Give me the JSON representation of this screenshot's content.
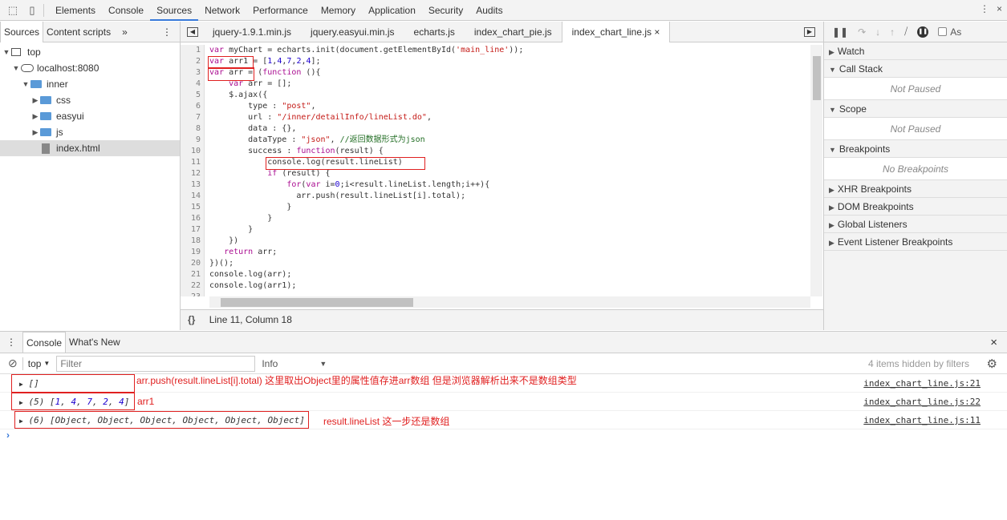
{
  "toolbar": {
    "tabs": [
      "Elements",
      "Console",
      "Sources",
      "Network",
      "Performance",
      "Memory",
      "Application",
      "Security",
      "Audits"
    ],
    "active": "Sources"
  },
  "navigator": {
    "tabs": [
      "Sources",
      "Content scripts"
    ],
    "more": "»",
    "tree": {
      "top": "top",
      "host": "localhost:8080",
      "inner": "inner",
      "css": "css",
      "easyui": "easyui",
      "js": "js",
      "index": "index.html"
    }
  },
  "editor": {
    "tabs": [
      "jquery-1.9.1.min.js",
      "jquery.easyui.min.js",
      "echarts.js",
      "index_chart_pie.js",
      "index_chart_line.js"
    ],
    "close": "×",
    "status": "Line 11, Column 18",
    "format_icon": "{}",
    "lines": [
      [
        [
          "var",
          "kw"
        ],
        [
          " myChart = echarts.init(document.getElementById(",
          ""
        ],
        [
          "'main_line'",
          "str"
        ],
        [
          "));",
          ""
        ]
      ],
      [
        [
          "var",
          "kw"
        ],
        [
          " arr1 = [",
          ""
        ],
        [
          "1",
          "num"
        ],
        [
          ",",
          ""
        ],
        [
          "4",
          "num"
        ],
        [
          ",",
          ""
        ],
        [
          "7",
          "num"
        ],
        [
          ",",
          ""
        ],
        [
          "2",
          "num"
        ],
        [
          ",",
          ""
        ],
        [
          "4",
          "num"
        ],
        [
          "];",
          ""
        ]
      ],
      [
        [
          "var",
          "kw"
        ],
        [
          " arr = (",
          ""
        ],
        [
          "function",
          "kw"
        ],
        [
          " (){",
          ""
        ]
      ],
      [
        [
          "    ",
          ""
        ],
        [
          "var",
          "kw"
        ],
        [
          " arr = [];",
          ""
        ]
      ],
      [
        [
          "    $.ajax({",
          ""
        ]
      ],
      [
        [
          "        type : ",
          ""
        ],
        [
          "\"post\"",
          "str"
        ],
        [
          ",",
          ""
        ]
      ],
      [
        [
          "        url : ",
          ""
        ],
        [
          "\"/inner/detailInfo/lineList.do\"",
          "str"
        ],
        [
          ",",
          ""
        ]
      ],
      [
        [
          "        data : {},",
          ""
        ]
      ],
      [
        [
          "        dataType : ",
          ""
        ],
        [
          "\"json\"",
          "str"
        ],
        [
          ", ",
          ""
        ],
        [
          "//返回数据形式为json",
          "cm"
        ]
      ],
      [
        [
          "        success : ",
          ""
        ],
        [
          "function",
          "kw"
        ],
        [
          "(result) {",
          ""
        ]
      ],
      [
        [
          "            console.log(result.lineList)",
          ""
        ]
      ],
      [
        [
          "            ",
          ""
        ],
        [
          "if",
          "kw"
        ],
        [
          " (result) {",
          ""
        ]
      ],
      [
        [
          "                ",
          ""
        ],
        [
          "for",
          "kw"
        ],
        [
          "(",
          ""
        ],
        [
          "var",
          "kw"
        ],
        [
          " i=",
          ""
        ],
        [
          "0",
          "num"
        ],
        [
          ";i<result.lineList.length;i++){",
          ""
        ]
      ],
      [
        [
          "                  arr.push(result.lineList[i].total);",
          ""
        ]
      ],
      [
        [
          "                }",
          ""
        ]
      ],
      [
        [
          "            }",
          ""
        ]
      ],
      [
        [
          "        }",
          ""
        ]
      ],
      [
        [
          "    })",
          ""
        ]
      ],
      [
        [
          "   ",
          ""
        ],
        [
          "return",
          "kw"
        ],
        [
          " arr;",
          ""
        ]
      ],
      [
        [
          "})();",
          ""
        ]
      ],
      [
        [
          "console.log(arr);",
          ""
        ]
      ],
      [
        [
          "console.log(arr1);",
          ""
        ]
      ],
      [
        [
          "",
          ""
        ]
      ],
      [
        [
          "",
          ""
        ]
      ]
    ]
  },
  "debugger": {
    "async_label": "As",
    "sections": [
      "Watch",
      "Call Stack",
      "Scope",
      "Breakpoints",
      "XHR Breakpoints",
      "DOM Breakpoints",
      "Global Listeners",
      "Event Listener Breakpoints"
    ],
    "not_paused": "Not Paused",
    "no_breakpoints": "No Breakpoints"
  },
  "console": {
    "tabs": [
      "Console",
      "What's New"
    ],
    "context": "top",
    "filter_placeholder": "Filter",
    "level": "Info",
    "hidden": "4 items hidden by filters",
    "messages": [
      {
        "text": "[]",
        "source": "index_chart_line.js:21",
        "annotation": "arr.push(result.lineList[i].total)  这里取出Object里的属性值存进arr数组  但是浏览器解析出来不是数组类型"
      },
      {
        "prefix": "(5) [",
        "nums": [
          "1",
          "4",
          "7",
          "2",
          "4"
        ],
        "source": "index_chart_line.js:22",
        "annotation": "arr1"
      },
      {
        "text": "(6) [Object, Object, Object, Object, Object, Object]",
        "source": "index_chart_line.js:11",
        "annotation": "result.lineList  这一步还是数组"
      }
    ],
    "prompt": "›"
  }
}
